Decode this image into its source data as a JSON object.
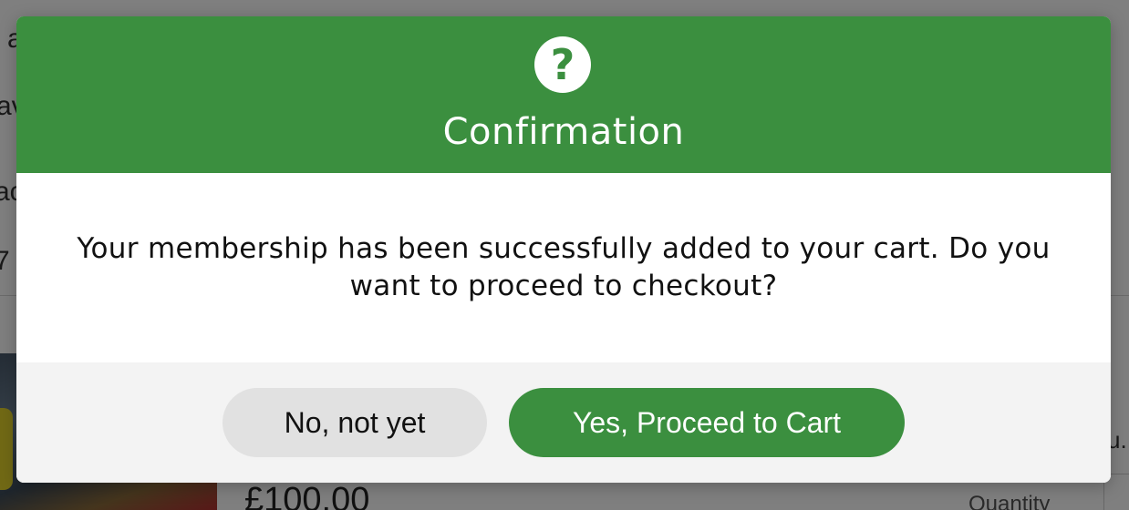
{
  "background": {
    "row_fragments": [
      "a",
      "av",
      "ac",
      "7"
    ],
    "price": "£100.00",
    "quantity_label": "Quantity",
    "right_fragment": "u."
  },
  "modal": {
    "icon": "question-circle-icon",
    "title": "Confirmation",
    "message": "Your membership has been successfully added to your cart. Do you want to proceed to checkout?",
    "buttons": {
      "no_label": "No, not yet",
      "yes_label": "Yes, Proceed to Cart"
    }
  },
  "colors": {
    "accent": "#3b8f3f",
    "footer_bg": "#f3f3f3",
    "secondary_button": "#e1e1e1"
  }
}
